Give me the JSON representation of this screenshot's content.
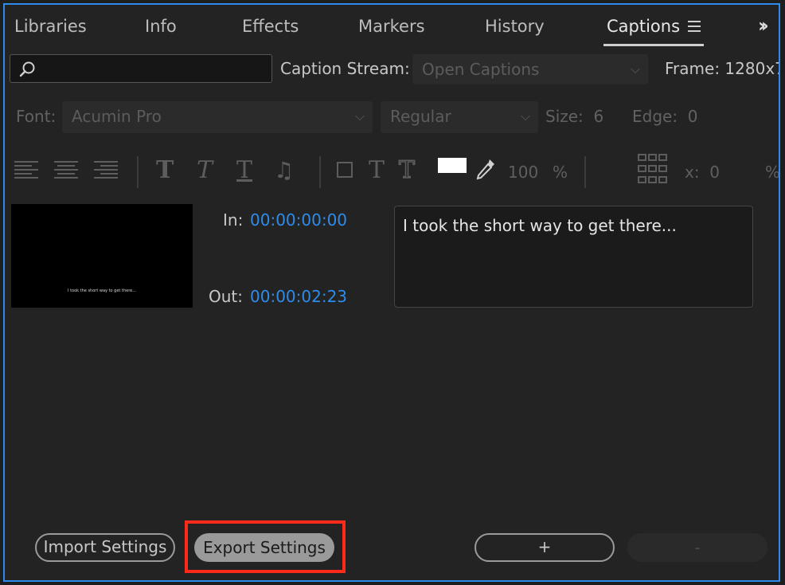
{
  "tabs": [
    {
      "label": "Libraries"
    },
    {
      "label": "Info"
    },
    {
      "label": "Effects"
    },
    {
      "label": "Markers"
    },
    {
      "label": "History"
    },
    {
      "label": "Captions",
      "active": true
    }
  ],
  "search": {
    "placeholder": "",
    "value": ""
  },
  "caption_stream": {
    "label": "Caption Stream:",
    "value": "Open Captions"
  },
  "frame": {
    "label": "Frame:",
    "value": "1280x7"
  },
  "font": {
    "label": "Font:",
    "value": "Acumin Pro"
  },
  "style": {
    "value": "Regular"
  },
  "size": {
    "label": "Size:",
    "value": "6"
  },
  "edge": {
    "label": "Edge:",
    "value": "0"
  },
  "toolbar": {
    "opacity_value": "100",
    "opacity_unit": "%",
    "x_label": "x:",
    "x_value": "0",
    "x_unit": "%",
    "swatch_color": "#ffffff"
  },
  "caption": {
    "in_label": "In:",
    "in_value": "00:00:00:00",
    "out_label": "Out:",
    "out_value": "00:00:02:23",
    "text": "I took the short way to get there...",
    "preview_text": "I took the short way to get there..."
  },
  "buttons": {
    "import": "Import Settings",
    "export": "Export Settings",
    "add": "+",
    "remove": "-"
  },
  "colors": {
    "accent": "#2d8ceb",
    "highlight": "#ff2a1a",
    "panel_bg": "#232323"
  }
}
